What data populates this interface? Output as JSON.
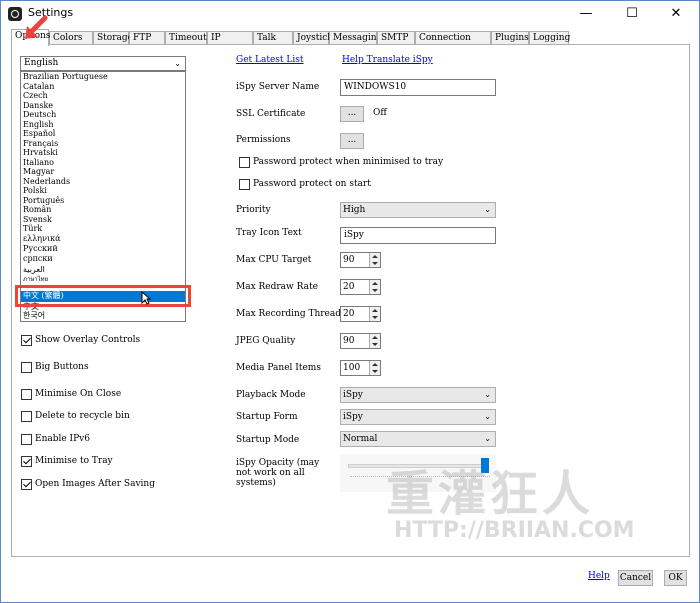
{
  "window": {
    "title": "Settings",
    "minimize_glyph": "—",
    "maximize_glyph": "☐",
    "close_glyph": "✕"
  },
  "tabs": [
    "Options",
    "Colors",
    "Storage",
    "FTP",
    "Timeouts",
    "IP Access",
    "Talk",
    "Joystick",
    "Messaging",
    "SMTP",
    "Connection Alerts",
    "Plugins",
    "Logging"
  ],
  "language": {
    "selected": "English",
    "options": [
      "Brazilian Portuguese",
      "Catalan",
      "Czech",
      "Danske",
      "Deutsch",
      "English",
      "Español",
      "Français",
      "Hrvatski",
      "Italiano",
      "Magyar",
      "Nederlands",
      "Polski",
      "Português",
      "Român",
      "Svensk",
      "Türk",
      "ελληνικά",
      "Русский",
      "српски",
      "العربية",
      "ภาษาไทย",
      "中文 (繁體)",
      "中文",
      "한국어"
    ],
    "highlighted": "中文 (繁體)"
  },
  "left_options": [
    {
      "label": "Show Overlay Controls",
      "checked": true
    },
    {
      "label": "Big Buttons",
      "checked": false
    },
    {
      "label": "Minimise On Close",
      "checked": false
    },
    {
      "label": "Delete to recycle bin",
      "checked": false
    },
    {
      "label": "Enable IPv6",
      "checked": false
    },
    {
      "label": "Minimise to Tray",
      "checked": true
    },
    {
      "label": "Open Images After Saving",
      "checked": true
    }
  ],
  "links": {
    "latest_list": "Get Latest List",
    "translate": "Help Translate iSpy",
    "help": "Help"
  },
  "fields": {
    "server_name_label": "iSpy Server Name",
    "server_name_value": "WINDOWS10",
    "ssl_label": "SSL Certificate",
    "ssl_button": "...",
    "ssl_status": "Off",
    "permissions_label": "Permissions",
    "permissions_button": "...",
    "pw_minimised": {
      "label": "Password protect when minimised to tray",
      "checked": false
    },
    "pw_startup": {
      "label": "Password protect on start",
      "checked": false
    },
    "priority_label": "Priority",
    "priority_value": "High",
    "tray_label": "Tray Icon Text",
    "tray_value": "iSpy",
    "max_cpu_label": "Max CPU Target",
    "max_cpu_value": "90",
    "max_redraw_label": "Max Redraw Rate",
    "max_redraw_value": "20",
    "max_threads_label": "Max Recording Threads",
    "max_threads_value": "20",
    "jpeg_label": "JPEG Quality",
    "jpeg_value": "90",
    "media_label": "Media Panel Items",
    "media_value": "100",
    "playback_label": "Playback Mode",
    "playback_value": "iSpy",
    "startup_form_label": "Startup Form",
    "startup_form_value": "iSpy",
    "startup_mode_label": "Startup Mode",
    "startup_mode_value": "Normal",
    "opacity_label": "iSpy Opacity (may not work on all systems)",
    "opacity_level": 1.0
  },
  "watermark": {
    "cjk": "重灌狂人",
    "url": "HTTP://BRIIAN.COM"
  },
  "buttons": {
    "cancel": "Cancel",
    "ok": "OK"
  },
  "colors": {
    "highlight": "#0078d7",
    "annotation_red": "#e8453c",
    "link": "#0000ee"
  }
}
